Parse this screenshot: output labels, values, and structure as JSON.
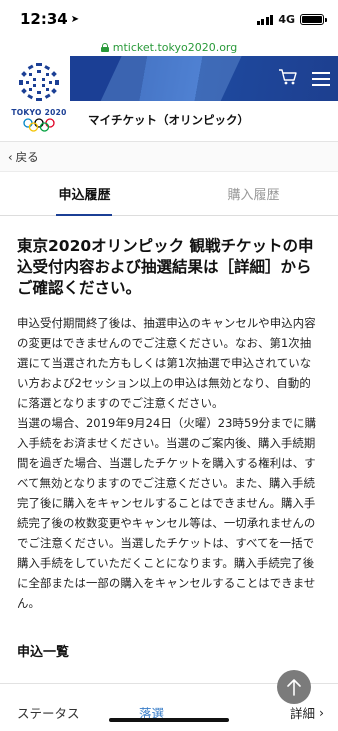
{
  "status_bar": {
    "time": "12:34",
    "network": "4G"
  },
  "url_bar": {
    "url": "mticket.tokyo2020.org"
  },
  "header": {
    "logo_text": "TOKYO 2020",
    "page_heading": "マイチケット（オリンピック）",
    "icons": [
      "cart-icon",
      "menu-icon"
    ]
  },
  "nav": {
    "back_label": "戻る"
  },
  "tabs": [
    {
      "label": "申込履歴",
      "active": true
    },
    {
      "label": "購入履歴",
      "active": false
    }
  ],
  "notice": {
    "title": "東京2020オリンピック 観戦チケットの申込受付内容および抽選結果は［詳細］からご確認ください。",
    "paragraph_1": "申込受付期間終了後は、抽選申込のキャンセルや申込内容の変更はできませんのでご注意ください。なお、第1次抽選にて当選された方もしくは第1次抽選で申込されていない方および2セッション以上の申込は無効となり、自動的に落選となりますのでご注意ください。",
    "paragraph_2": "当選の場合、2019年9月24日（火曜）23時59分までに購入手続をお済ませください。当選のご案内後、購入手続期間を過ぎた場合、当選したチケットを購入する権利は、すべて無効となりますのでご注意ください。また、購入手続完了後に購入をキャンセルすることはできません。購入手続完了後の枚数変更やキャンセル等は、一切承れませんのでご注意ください。当選したチケットは、すべてを一括で購入手続をしていただくことになります。購入手続完了後に全部または一部の購入をキャンセルすることはできません。"
  },
  "list_section": {
    "title": "申込一覧",
    "status_label": "ステータス",
    "status_value": "落選",
    "detail_label": "詳細"
  },
  "colors": {
    "brand_blue": "#1b3f95",
    "url_green": "#2a9a3a",
    "link_blue": "#3a7ec8"
  }
}
